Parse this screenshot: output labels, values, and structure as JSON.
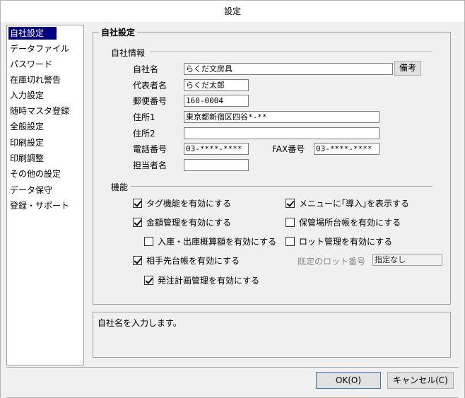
{
  "window": {
    "title": "設定"
  },
  "sidebar": {
    "items": [
      {
        "label": "自社設定",
        "selected": true
      },
      {
        "label": "データファイル"
      },
      {
        "label": "パスワード"
      },
      {
        "label": "在庫切れ警告"
      },
      {
        "label": "入力設定"
      },
      {
        "label": "随時マスタ登録"
      },
      {
        "label": "全般設定"
      },
      {
        "label": "印刷設定"
      },
      {
        "label": "印刷調整"
      },
      {
        "label": "その他の設定"
      },
      {
        "label": "データ保守"
      },
      {
        "label": "登録・サポート"
      }
    ]
  },
  "main": {
    "group_title": "自社設定",
    "company_info": {
      "section_label": "自社情報",
      "company_name_label": "自社名",
      "company_name_value": "らくだ文房具",
      "notes_button": "備考",
      "representative_label": "代表者名",
      "representative_value": "らくだ太郎",
      "postal_label": "郵便番号",
      "postal_value": "160-0004",
      "address1_label": "住所1",
      "address1_value": "東京都新宿区四谷*-**",
      "address2_label": "住所2",
      "address2_value": "",
      "phone_label": "電話番号",
      "phone_value": "03-****-****",
      "fax_label": "FAX番号",
      "fax_value": "03-****-****",
      "staff_label": "担当者名",
      "staff_value": ""
    },
    "features": {
      "section_label": "機能",
      "tag": {
        "label": "タグ機能を有効にする",
        "checked": true
      },
      "menu_import": {
        "label": "メニューに｢導入｣を表示する",
        "checked": true
      },
      "amount_mgmt": {
        "label": "金額管理を有効にする",
        "checked": true
      },
      "storage_ledger": {
        "label": "保管場所台帳を有効にする",
        "checked": false
      },
      "io_estimate": {
        "label": "入庫・出庫概算額を有効にする",
        "checked": false
      },
      "lot_mgmt": {
        "label": "ロット管理を有効にする",
        "checked": false
      },
      "partner_ledger": {
        "label": "相手先台帳を有効にする",
        "checked": true
      },
      "default_lot_label": "既定のロット番号",
      "default_lot_value": "指定なし",
      "order_plan": {
        "label": "発注計画管理を有効にする",
        "checked": true
      }
    }
  },
  "help": {
    "text": "自社名を入力します。"
  },
  "buttons": {
    "ok": "OK(O)",
    "cancel": "キャンセル(C)"
  }
}
